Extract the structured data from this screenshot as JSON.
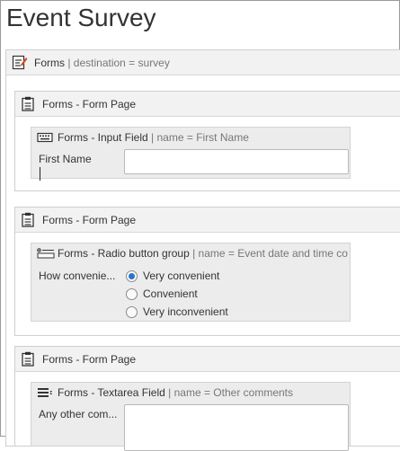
{
  "page": {
    "title": "Event Survey"
  },
  "forms": {
    "label": "Forms",
    "meta": "| destination = survey",
    "pages": [
      {
        "label": "Forms - Form Page",
        "field": {
          "type_label": "Forms - Input Field",
          "meta": "| name = First Name",
          "label": "First Name",
          "value": ""
        }
      },
      {
        "label": "Forms - Form Page",
        "field": {
          "type_label": "Forms - Radio button group",
          "meta": "| name = Event date and time co",
          "label": "How convenie...",
          "options": [
            {
              "label": "Very convenient",
              "selected": true
            },
            {
              "label": "Convenient",
              "selected": false
            },
            {
              "label": "Very inconvenient",
              "selected": false
            }
          ]
        }
      },
      {
        "label": "Forms - Form Page",
        "field": {
          "type_label": "Forms - Textarea Field",
          "meta": "| name = Other comments",
          "label": "Any other com...",
          "value": ""
        }
      }
    ]
  },
  "icons": {
    "forms": "form-edit-icon",
    "page": "clipboard-icon",
    "input": "keyboard-icon",
    "radio": "radio-list-icon",
    "textarea": "textarea-lines-icon"
  },
  "colors": {
    "radio_selected": "#2a73c8",
    "header_bg": "#f2f2f2",
    "field_bg": "#ececec"
  }
}
